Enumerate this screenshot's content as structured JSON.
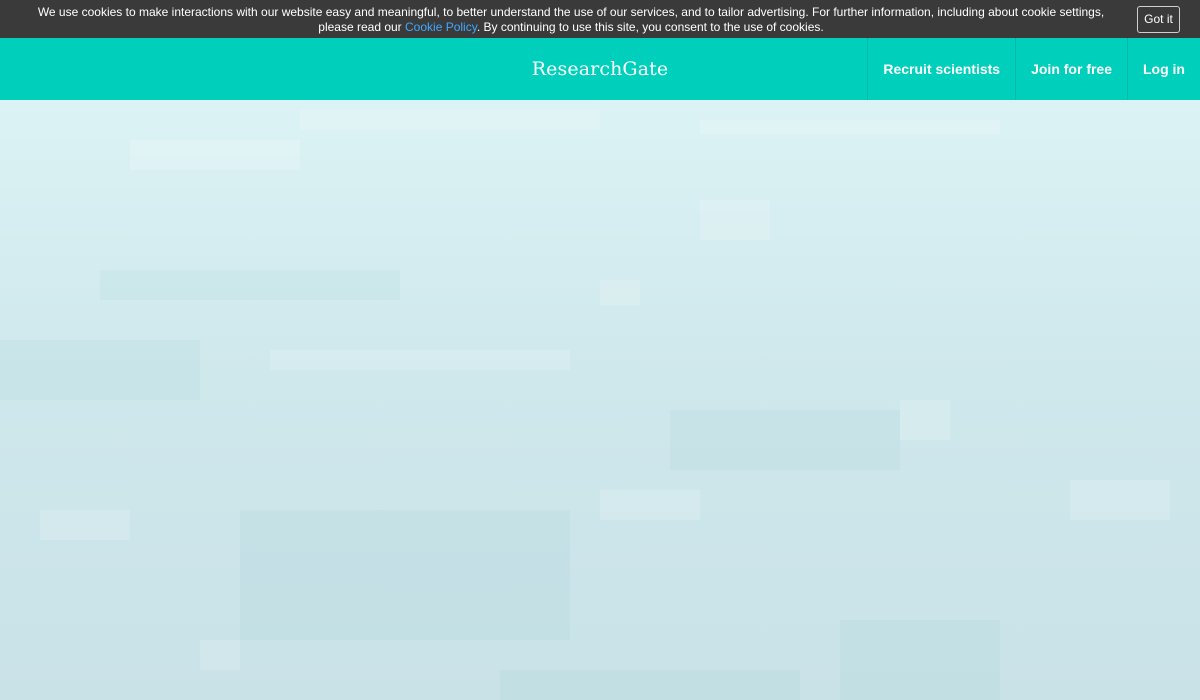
{
  "cookie_banner": {
    "text_before": "We use cookies to make interactions with our website easy and meaningful, to better understand the use of our services, and to tailor advertising. For further information, including about cookie settings, please read our ",
    "link_text": "Cookie Policy",
    "text_after": ". By continuing to use this site, you consent to the use of cookies.",
    "accept_label": "Got it"
  },
  "header": {
    "logo": "ResearchGate",
    "nav": [
      "Recruit scientists",
      "Join for free",
      "Log in"
    ]
  },
  "colors": {
    "header": "#00d0bb",
    "cookie_bar": "#3a3a3a",
    "link": "#40a9ff"
  }
}
